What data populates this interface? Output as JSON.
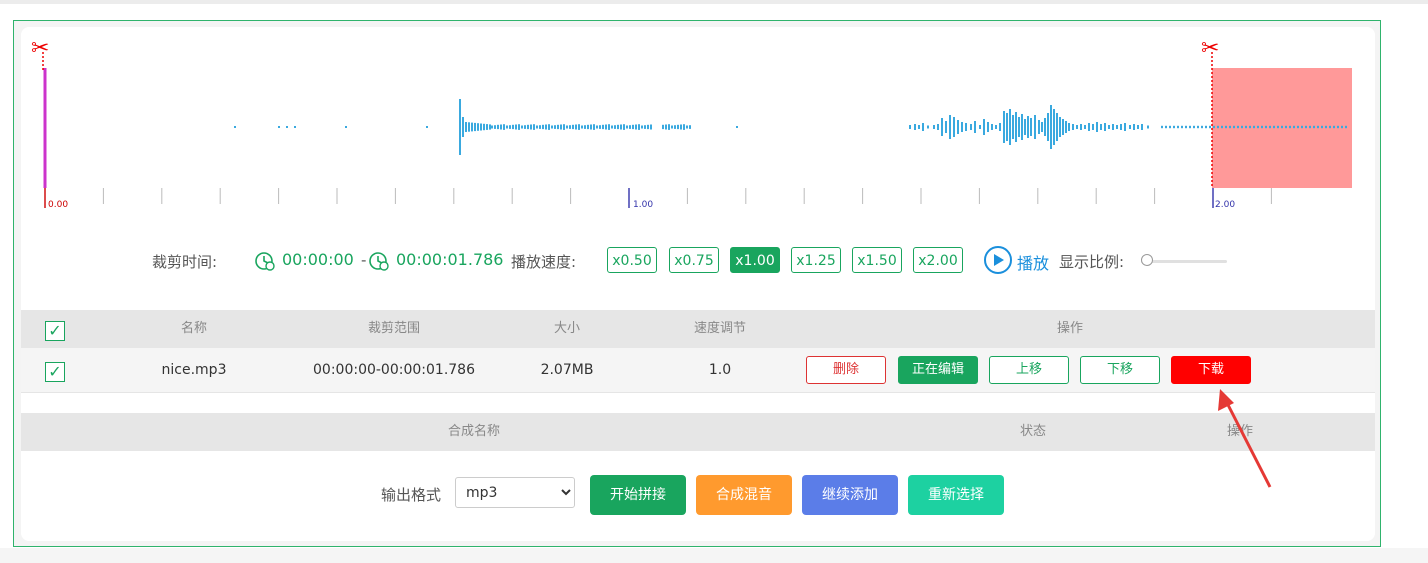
{
  "trim": {
    "label": "裁剪时间:",
    "start": "00:00:00",
    "end_prefix": "-",
    "end": "00:00:01.786"
  },
  "speed": {
    "label": "播放速度:",
    "options": [
      "x0.50",
      "x0.75",
      "x1.00",
      "x1.25",
      "x1.50",
      "x2.00"
    ],
    "selected": "x1.00"
  },
  "play_label": "播放",
  "ratio_label": "显示比例:",
  "ruler": {
    "labels": [
      "0.00",
      "1.00",
      "2.00"
    ]
  },
  "table": {
    "headers": [
      "名称",
      "裁剪范围",
      "大小",
      "速度调节",
      "操作"
    ],
    "rows": [
      {
        "checked": true,
        "name": "nice.mp3",
        "range": "00:00:00-00:00:01.786",
        "size": "2.07MB",
        "speed": "1.0"
      }
    ],
    "header_checked": true,
    "actions": {
      "delete": "删除",
      "editing": "正在编辑",
      "move_up": "上移",
      "move_down": "下移",
      "download": "下载"
    }
  },
  "merge_table": {
    "headers": [
      "合成名称",
      "状态",
      "操作"
    ]
  },
  "output": {
    "label": "输出格式",
    "format": "mp3",
    "options": [
      "mp3"
    ]
  },
  "buttons": {
    "start_concat": "开始拼接",
    "mix": "合成混音",
    "continue_add": "继续添加",
    "reselect": "重新选择"
  },
  "colors": {
    "accent": "#19a55e",
    "wave": "#3aa9df",
    "selection": "#ff9999",
    "download": "#ff0000",
    "mix": "#ff9a2e",
    "continue_add": "#5b7de8",
    "reselect": "#1dd1a1"
  }
}
